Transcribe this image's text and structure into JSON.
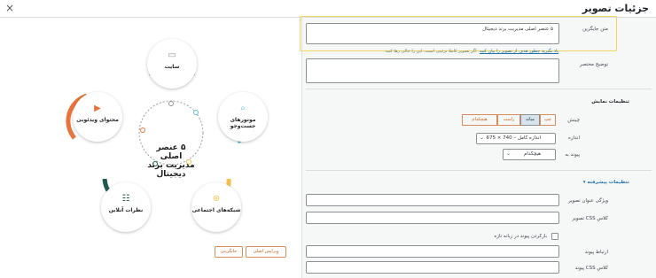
{
  "dialog": {
    "title": "جزئیات تصویر",
    "close_glyph": "×"
  },
  "settings": {
    "alt_text": {
      "label": "متن جایگزین",
      "value": "۵ عنصر اصلی مدیریت برند دیجیتال",
      "help_link": "یاد بگیرید چطور هدف از تصویر را بیان کنید",
      "help_rest": ". اگر تصویر کاملا تزئینی است، این را خالی رها کنید."
    },
    "caption": {
      "label": "توضیح مختصر",
      "value": ""
    },
    "display_section": "تنظیمات نمایش",
    "alignment": {
      "label": "چینش",
      "options": [
        "چپ",
        "میانه",
        "راست",
        "هیچکدام"
      ],
      "selected": "میانه"
    },
    "size": {
      "label": "اندازه",
      "value": "اندازه کامل – 740 × 675"
    },
    "link_to": {
      "label": "پیوند به",
      "value": "هیچکدام"
    },
    "advanced_section": "تنظیمات پیشرفته ▾",
    "title_attr": {
      "label": "ویژگی عنوان تصویر",
      "value": ""
    },
    "image_css": {
      "label": "کلاس CSS تصویر",
      "value": ""
    },
    "new_tab": {
      "label": "بازکردن پیوند در زبانه تازه"
    },
    "link_rel": {
      "label": "ارتباط پیوند",
      "value": ""
    },
    "link_css": {
      "label": "کلاس CSS پیوند",
      "value": ""
    }
  },
  "preview": {
    "center_title": "۵ عنصر اصلی مدیریت برند دیجیتال",
    "items": {
      "site": "سایت",
      "search": "موتورهای جست‌وجو",
      "social": "شبکه‌های اجتماعی",
      "reviews": "نظرات آنلاین",
      "video": "محتوای ویدئویی"
    },
    "colors": {
      "site": "#8a8f93",
      "search": "#5fbfcb",
      "social": "#f2c14e",
      "reviews": "#1f5b52",
      "video": "#e8743b"
    },
    "buttons": {
      "edit_original": "ویرایش اصلی",
      "replace": "جایگزینی"
    }
  }
}
